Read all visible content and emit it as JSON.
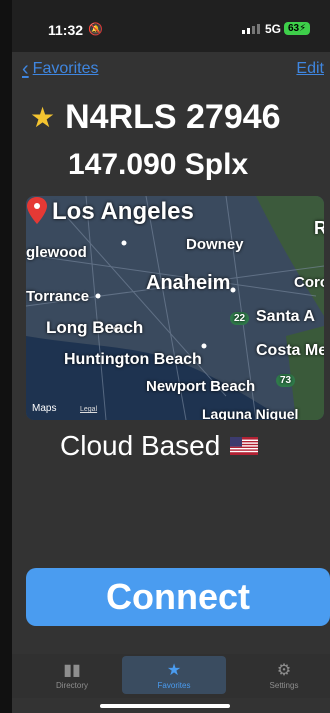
{
  "status": {
    "time": "11:32",
    "network": "5G",
    "battery": "63"
  },
  "nav": {
    "back_label": "Favorites",
    "edit_label": "Edit"
  },
  "repeater": {
    "name": "N4RLS 27946",
    "frequency": "147.090 Splx",
    "type": "Cloud Based"
  },
  "map": {
    "labels": {
      "los_angeles": "Los Angeles",
      "inglewood": "glewood",
      "downey": "Downey",
      "anaheim": "Anaheim",
      "corona": "Coro",
      "torrance": "Torrance",
      "long_beach": "Long Beach",
      "santa_ana": "Santa A",
      "huntington_beach": "Huntington Beach",
      "costa_mesa": "Costa Me",
      "newport_beach": "Newport Beach",
      "laguna_niguel": "Laguna Niguel",
      "route_22": "22",
      "route_73": "73",
      "r_edge": "R"
    },
    "brand": "Maps",
    "legal": "Legal"
  },
  "connect_label": "Connect",
  "tabs": [
    {
      "label": "Directory",
      "icon": "book-icon"
    },
    {
      "label": "Favorites",
      "icon": "star-icon"
    },
    {
      "label": "Settings",
      "icon": "gear-icon"
    }
  ],
  "colors": {
    "accent": "#4a9cf0",
    "star": "#f4c430",
    "background": "#333333",
    "battery": "#3ecf4a"
  }
}
